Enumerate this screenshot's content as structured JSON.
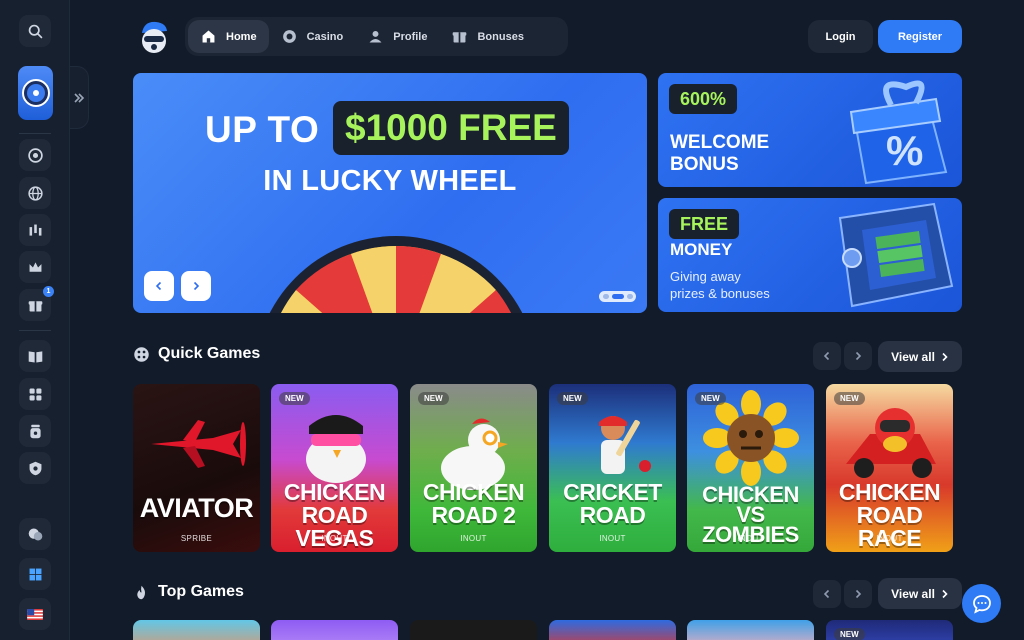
{
  "header": {
    "nav": [
      {
        "label": "Home",
        "icon": "home-icon",
        "active": true
      },
      {
        "label": "Casino",
        "icon": "chip-icon",
        "active": false
      },
      {
        "label": "Profile",
        "icon": "user-icon",
        "active": false
      },
      {
        "label": "Bonuses",
        "icon": "gift-icon",
        "active": false
      }
    ],
    "login_label": "Login",
    "register_label": "Register"
  },
  "hero": {
    "line1": "UP TO",
    "highlight": "$1000 FREE",
    "line2": "IN LUCKY WHEEL"
  },
  "promos": [
    {
      "pill": "600%",
      "title": "WELCOME",
      "title2": "BONUS"
    },
    {
      "pill": "FREE",
      "title": "MONEY",
      "sub1": "Giving away",
      "sub2": "prizes & bonuses"
    }
  ],
  "quick_games": {
    "title": "Quick Games",
    "view_all": "View all",
    "games": [
      {
        "name": "AVIATOR",
        "provider": "SPRIBE",
        "badge": ""
      },
      {
        "name": "CHICKEN ROAD VEGAS",
        "provider": "INOUT",
        "badge": "NEW"
      },
      {
        "name": "CHICKEN ROAD 2",
        "provider": "INOUT",
        "badge": "NEW"
      },
      {
        "name": "CRICKET ROAD",
        "provider": "INOUT",
        "badge": "NEW"
      },
      {
        "name": "CHICKEN VS ZOMBIES",
        "provider": "INOUT",
        "badge": "NEW"
      },
      {
        "name": "CHICKEN ROAD RACE",
        "provider": "INOUT",
        "badge": "NEW"
      }
    ]
  },
  "top_games": {
    "title": "Top Games",
    "view_all": "View all",
    "badge_last": "NEW"
  },
  "colors": {
    "background": "#121b2a",
    "accent": "#2f7bf5",
    "highlight_green": "#a6f35c"
  }
}
